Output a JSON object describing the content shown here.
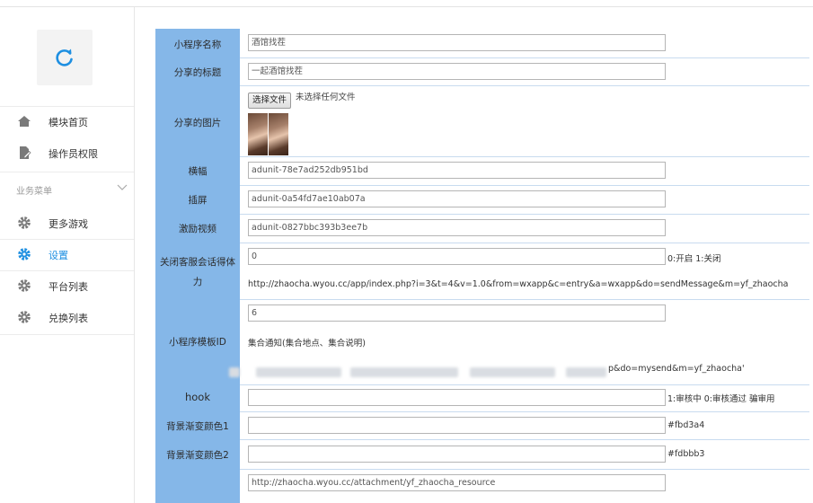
{
  "sidebar": {
    "items": [
      {
        "label": "模块首页",
        "icon": "home-icon"
      },
      {
        "label": "操作员权限",
        "icon": "document-edit-icon"
      }
    ],
    "group_label": "业务菜单",
    "group_items": [
      {
        "label": "更多游戏",
        "icon": "gear-icon"
      },
      {
        "label": "设置",
        "icon": "gear-icon",
        "active": true
      },
      {
        "label": "平台列表",
        "icon": "gear-icon"
      },
      {
        "label": "兑换列表",
        "icon": "gear-icon"
      }
    ],
    "accent_color": "#1e8fe1"
  },
  "form": {
    "app_name": {
      "label": "小程序名称",
      "value": "酒馆找茬"
    },
    "share_title": {
      "label": "分享的标题",
      "value": "一起酒馆找茬"
    },
    "share_image": {
      "label": "分享的图片",
      "button": "选择文件",
      "status": "未选择任何文件"
    },
    "banner": {
      "label": "横幅",
      "value": "adunit-78e7ad252db951bd"
    },
    "interstitial": {
      "label": "插屏",
      "value": "adunit-0a54fd7ae10ab07a"
    },
    "reward_video": {
      "label": "激励视频",
      "value": "adunit-0827bbc393b3ee7b"
    },
    "close_service": {
      "label": "关闭客服会话得体力",
      "value": "0",
      "hint": "0:开启 1:关闭",
      "url": "http://zhaocha.wyou.cc/app/index.php?i=3&t=4&v=1.0&from=wxapp&c=entry&a=wxapp&do=sendMessage&m=yf_zhaocha"
    },
    "template_id": {
      "label": "小程序模板ID",
      "value": "6",
      "note": "集合通知(集合地点、集合说明)",
      "url_tail": "p&do=mysend&m=yf_zhaocha'"
    },
    "hook": {
      "label": "hook",
      "value": "",
      "hint": "1:审核中 0:审核通过 骗审用"
    },
    "bg_color1": {
      "label": "背景渐变颜色1",
      "value": "",
      "hint": "#fbd3a4"
    },
    "bg_color2": {
      "label": "背景渐变颜色2",
      "value": "",
      "hint": "#fdbbb3"
    },
    "resource_url": {
      "value": "http://zhaocha.wyou.cc/attachment/yf_zhaocha_resource"
    }
  }
}
